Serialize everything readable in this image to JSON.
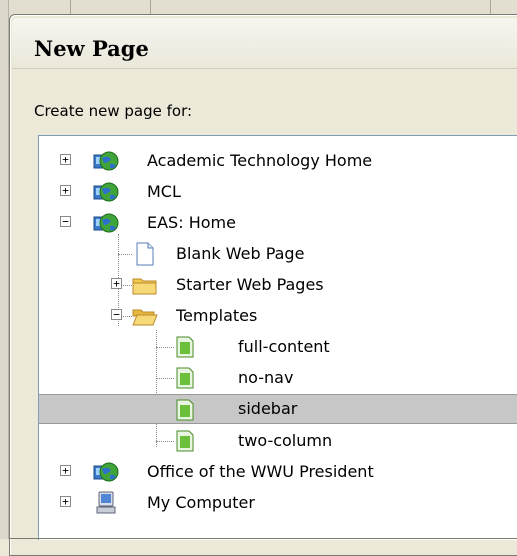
{
  "dialog": {
    "title": "New Page",
    "prompt": "Create new page for:"
  },
  "tree": {
    "items": [
      {
        "label": "Academic Technology Home",
        "icon": "web-site-globe-icon",
        "expander": "+",
        "selected": false
      },
      {
        "label": "MCL",
        "icon": "web-site-globe-icon",
        "expander": "+",
        "selected": false
      },
      {
        "label": "EAS: Home",
        "icon": "web-site-globe-icon",
        "expander": "−",
        "selected": false
      },
      {
        "label": "Blank Web Page",
        "icon": "blank-page-icon",
        "expander": "",
        "selected": false
      },
      {
        "label": "Starter Web Pages",
        "icon": "folder-icon",
        "expander": "+",
        "selected": false
      },
      {
        "label": "Templates",
        "icon": "folder-open-icon",
        "expander": "−",
        "selected": false
      },
      {
        "label": "full-content",
        "icon": "template-page-icon",
        "expander": "",
        "selected": false
      },
      {
        "label": "no-nav",
        "icon": "template-page-icon",
        "expander": "",
        "selected": false
      },
      {
        "label": "sidebar",
        "icon": "template-page-icon",
        "expander": "",
        "selected": true
      },
      {
        "label": "two-column",
        "icon": "template-page-icon",
        "expander": "",
        "selected": false
      },
      {
        "label": "Office of the WWU President",
        "icon": "web-site-globe-icon",
        "expander": "+",
        "selected": false
      },
      {
        "label": "My Computer",
        "icon": "my-computer-icon",
        "expander": "+",
        "selected": false
      }
    ]
  },
  "colors": {
    "dialog_bg": "#ece9d8",
    "selection": "#c7c7c7",
    "tree_border": "#7f9db9",
    "template_icon": "#6bbf3a"
  }
}
